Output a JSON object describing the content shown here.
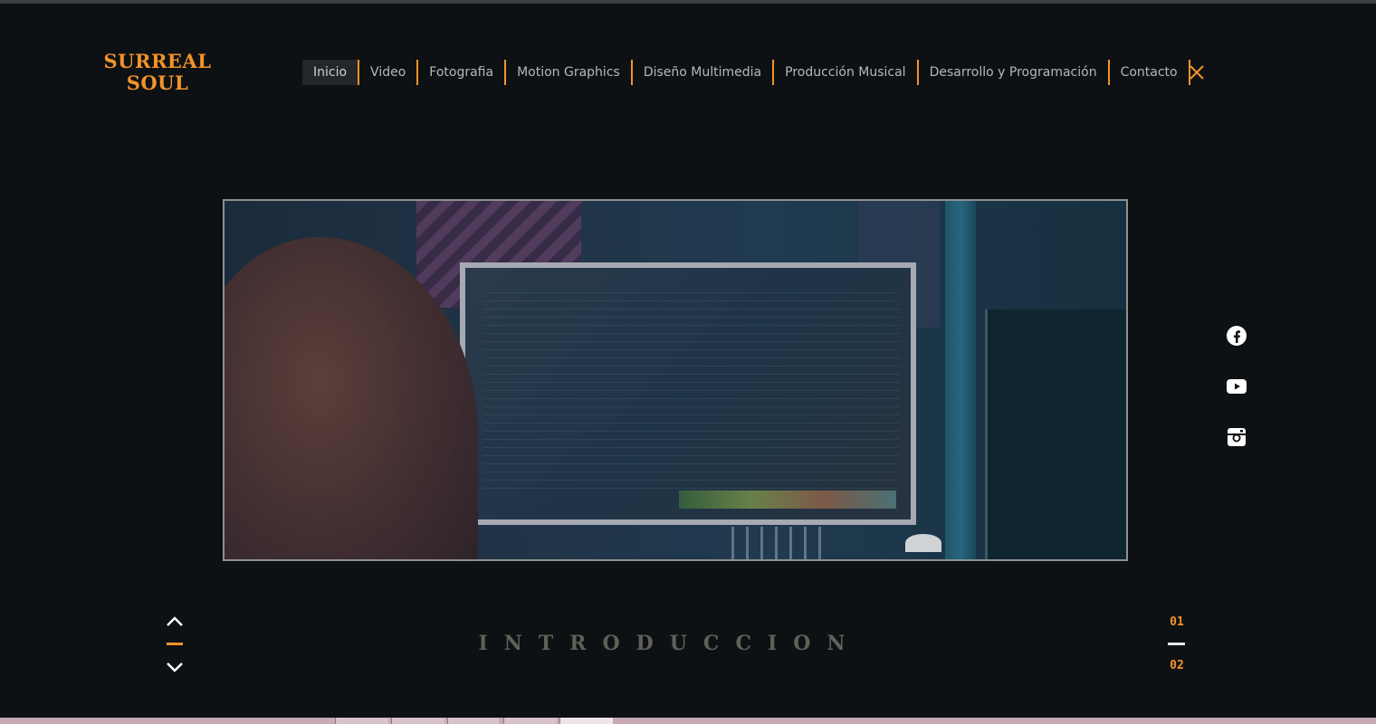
{
  "brand": {
    "line1": "SURREAL",
    "line2": "SOUL",
    "accent_color": "#f2932a"
  },
  "nav": {
    "items": [
      {
        "label": "Inicio",
        "active": true
      },
      {
        "label": "Video"
      },
      {
        "label": "Fotografia"
      },
      {
        "label": "Motion Graphics"
      },
      {
        "label": "Diseño Multimedia"
      },
      {
        "label": "Producción Musical"
      },
      {
        "label": "Desarrollo y Programación"
      },
      {
        "label": "Contacto"
      }
    ],
    "close_icon": "close-icon"
  },
  "hero": {
    "image_description": "hooded-person-at-computer-monitor"
  },
  "social": {
    "icons": [
      "facebook-icon",
      "youtube-icon",
      "instagram-icon"
    ]
  },
  "section": {
    "title": "INTRODUCCION"
  },
  "pager": {
    "current": "01",
    "next": "02",
    "up_icon": "chevron-up-icon",
    "down_icon": "chevron-down-icon"
  },
  "colors": {
    "background": "#0e1113",
    "accent": "#f2932a",
    "nav_text": "#b7b7b7",
    "section_title": "#5f6058"
  }
}
